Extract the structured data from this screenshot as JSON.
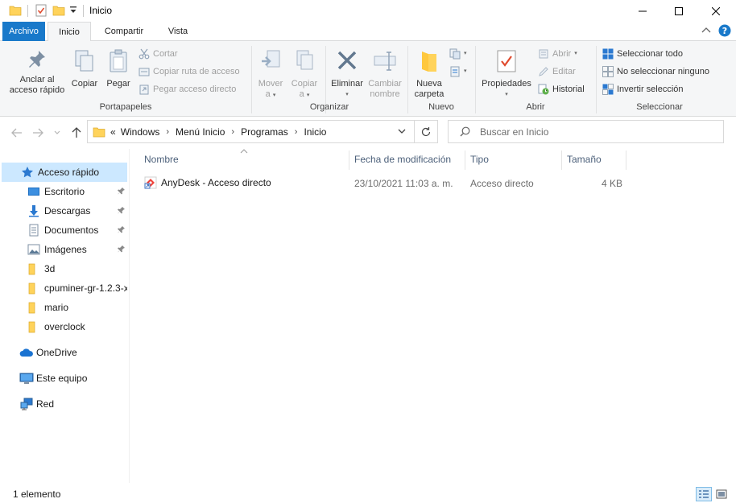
{
  "window": {
    "title": "Inicio"
  },
  "tabs": {
    "archivo": "Archivo",
    "inicio": "Inicio",
    "compartir": "Compartir",
    "vista": "Vista"
  },
  "ribbon": {
    "portapapeles": {
      "label": "Portapapeles",
      "pin_line1": "Anclar al",
      "pin_line2": "acceso rápido",
      "copy": "Copiar",
      "paste": "Pegar",
      "cut": "Cortar",
      "copy_path": "Copiar ruta de acceso",
      "paste_shortcut": "Pegar acceso directo"
    },
    "organizar": {
      "label": "Organizar",
      "move_line1": "Mover",
      "move_line2": "a",
      "copyto_line1": "Copiar",
      "copyto_line2": "a",
      "delete": "Eliminar",
      "rename_line1": "Cambiar",
      "rename_line2": "nombre"
    },
    "nuevo": {
      "label": "Nuevo",
      "folder_line1": "Nueva",
      "folder_line2": "carpeta"
    },
    "abrir": {
      "label": "Abrir",
      "properties": "Propiedades",
      "open": "Abrir",
      "edit": "Editar",
      "history": "Historial"
    },
    "seleccionar": {
      "label": "Seleccionar",
      "select_all": "Seleccionar todo",
      "select_none": "No seleccionar ninguno",
      "invert": "Invertir selección"
    }
  },
  "address": {
    "overflow": "«",
    "crumbs": [
      "Windows",
      "Menú Inicio",
      "Programas",
      "Inicio"
    ]
  },
  "search": {
    "placeholder": "Buscar en Inicio"
  },
  "navpane": {
    "quick_access": "Acceso rápido",
    "items": [
      {
        "label": "Escritorio",
        "icon": "desktop-icon",
        "pinned": true
      },
      {
        "label": "Descargas",
        "icon": "download-icon",
        "pinned": true
      },
      {
        "label": "Documentos",
        "icon": "document-icon",
        "pinned": true
      },
      {
        "label": "Imágenes",
        "icon": "pictures-icon",
        "pinned": true
      },
      {
        "label": "3d",
        "icon": "folder-icon",
        "pinned": false
      },
      {
        "label": "cpuminer-gr-1.2.3-x",
        "icon": "folder-icon",
        "pinned": false
      },
      {
        "label": "mario",
        "icon": "folder-icon",
        "pinned": false
      },
      {
        "label": "overclock",
        "icon": "folder-icon",
        "pinned": false
      }
    ],
    "onedrive": "OneDrive",
    "this_pc": "Este equipo",
    "network": "Red"
  },
  "filelist": {
    "columns": {
      "name": "Nombre",
      "modified": "Fecha de modificación",
      "type": "Tipo",
      "size": "Tamaño"
    },
    "rows": [
      {
        "name": "AnyDesk - Acceso directo",
        "modified": "23/10/2021 11:03 a. m.",
        "type": "Acceso directo",
        "size": "4 KB"
      }
    ]
  },
  "status": {
    "text": "1 elemento"
  },
  "colors": {
    "accent": "#1979ca",
    "selection": "#cce8ff",
    "folder": "#ffd35b"
  }
}
